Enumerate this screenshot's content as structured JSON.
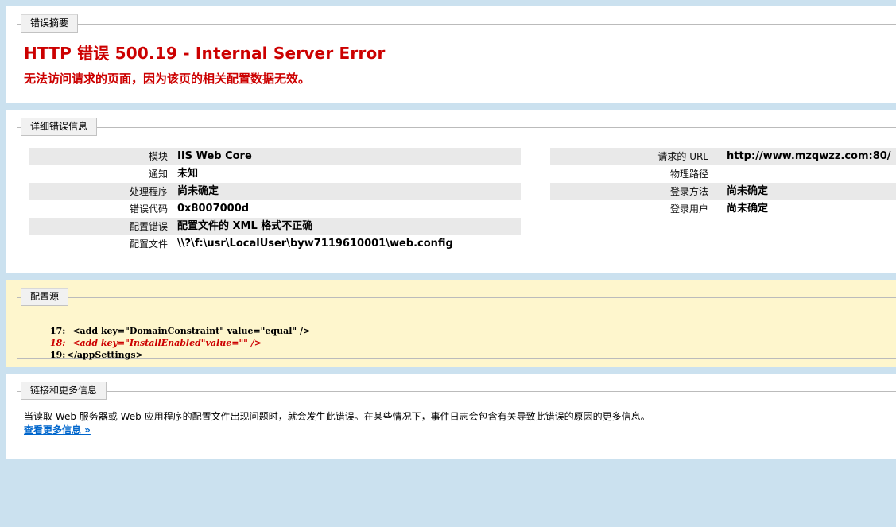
{
  "summary": {
    "legend": "错误摘要",
    "title": "HTTP 错误 500.19 - Internal Server Error",
    "subtitle": "无法访问请求的页面，因为该页的相关配置数据无效。"
  },
  "details": {
    "legend": "详细错误信息",
    "left": [
      {
        "label": "模块",
        "value": "IIS Web Core"
      },
      {
        "label": "通知",
        "value": "未知"
      },
      {
        "label": "处理程序",
        "value": "尚未确定"
      },
      {
        "label": "错误代码",
        "value": "0x8007000d"
      },
      {
        "label": "配置错误",
        "value": "配置文件的 XML 格式不正确"
      },
      {
        "label": "配置文件",
        "value": "\\\\?\\f:\\usr\\LocalUser\\byw7119610001\\web.config"
      }
    ],
    "right": [
      {
        "label": "请求的 URL",
        "value": "http://www.mzqwzz.com:80/"
      },
      {
        "label": "物理路径",
        "value": ""
      },
      {
        "label": "登录方法",
        "value": "尚未确定"
      },
      {
        "label": "登录用户",
        "value": "尚未确定"
      }
    ]
  },
  "config_source": {
    "legend": "配置源",
    "lines": [
      {
        "num": "17:",
        "text": "    <add key=\"DomainConstraint\" value=\"equal\" />"
      },
      {
        "num": "18:",
        "text": "    <add key=\"InstallEnabled\"value=\"\" />"
      },
      {
        "num": "19:",
        "text": "  </appSettings>"
      }
    ]
  },
  "more_info": {
    "legend": "链接和更多信息",
    "text": "当读取 Web 服务器或 Web 应用程序的配置文件出现问题时，就会发生此错误。在某些情况下，事件日志会包含有关导致此错误的原因的更多信息。",
    "link": "查看更多信息 »"
  },
  "colors": {
    "background": "#cbe1ef",
    "error_red": "#cc0000",
    "config_bg": "#fef6cd",
    "link_blue": "#0066cc"
  }
}
